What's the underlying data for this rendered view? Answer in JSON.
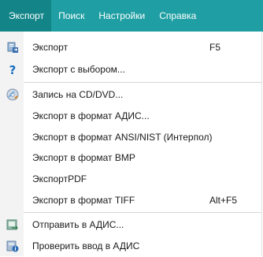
{
  "menubar": {
    "items": [
      {
        "label": "Экспорт"
      },
      {
        "label": "Поиск"
      },
      {
        "label": "Настройки"
      },
      {
        "label": "Справка"
      }
    ]
  },
  "dropdown": {
    "items": [
      {
        "label": "Экспорт",
        "shortcut": "F5",
        "icon": "export-database-icon"
      },
      {
        "label": "Экспорт с выбором...",
        "icon": "question-icon"
      },
      {
        "label": "Запись на CD/DVD...",
        "icon": "disc-icon"
      },
      {
        "label": "Экспорт в формат АДИС..."
      },
      {
        "label": "Экспорт в формат ANSI/NIST (Интерпол)"
      },
      {
        "label": "Экспорт в формат BMP"
      },
      {
        "label": "ЭкспортPDF"
      },
      {
        "label": "Экспорт в формат TIFF",
        "shortcut": "Alt+F5"
      },
      {
        "label": "Отправить в АДИС...",
        "icon": "send-icon"
      },
      {
        "label": "Проверить ввод в АДИС",
        "icon": "verify-icon"
      }
    ]
  },
  "colors": {
    "menubar": "#1f9fa3",
    "menubar_active": "#138589",
    "question_icon": "#1a6fc0"
  }
}
